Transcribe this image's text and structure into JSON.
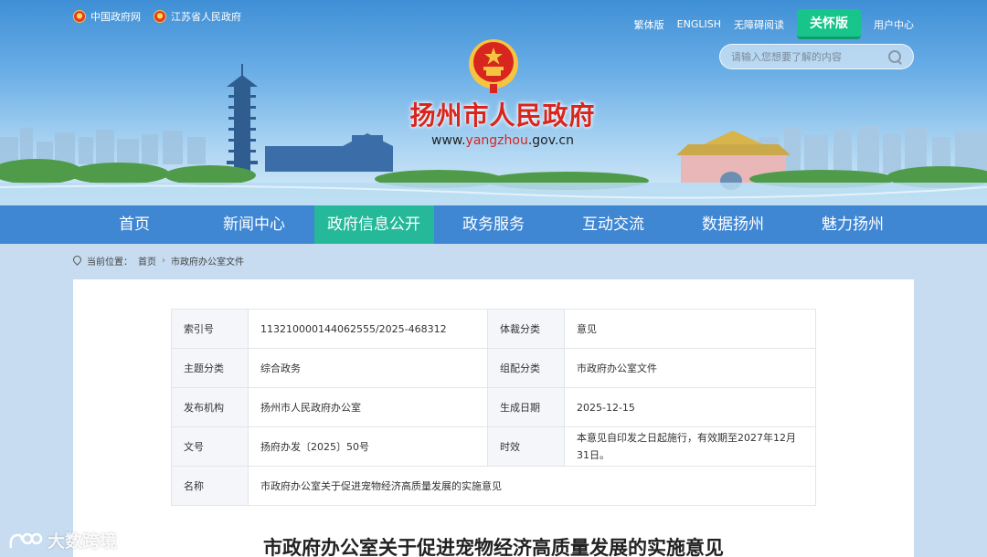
{
  "header": {
    "top_links": [
      "中国政府网",
      "江苏省人民政府"
    ],
    "right_links": [
      "繁体版",
      "ENGLISH",
      "无障碍阅读"
    ],
    "care_button": "关怀版",
    "user_center": "用户中心",
    "search_placeholder": "请输入您想要了解的内容",
    "site_title": "扬州市人民政府",
    "site_url_prefix": "www.",
    "site_url_highlight": "yangzhou",
    "site_url_suffix": ".gov.cn"
  },
  "nav": {
    "items": [
      "首页",
      "新闻中心",
      "政府信息公开",
      "政务服务",
      "互动交流",
      "数据扬州",
      "魅力扬州"
    ],
    "active_index": 2
  },
  "breadcrumb": {
    "label": "当前位置：",
    "items": [
      "首页",
      "市政府办公室文件"
    ]
  },
  "meta_table": {
    "rows": [
      {
        "k1": "索引号",
        "v1": "113210000144062555/2025-468312",
        "k2": "体裁分类",
        "v2": "意见"
      },
      {
        "k1": "主题分类",
        "v1": "综合政务",
        "k2": "组配分类",
        "v2": "市政府办公室文件"
      },
      {
        "k1": "发布机构",
        "v1": "扬州市人民政府办公室",
        "k2": "生成日期",
        "v2": "2025-12-15"
      },
      {
        "k1": "文号",
        "v1": "扬府办发〔2025〕50号",
        "k2": "时效",
        "v2": "本意见自印发之日起施行，有效期至2027年12月31日。"
      }
    ],
    "name_label": "名称",
    "name_value": "市政府办公室关于促进宠物经济高质量发展的实施意见"
  },
  "document": {
    "title": "市政府办公室关于促进宠物经济高质量发展的实施意见"
  },
  "watermark": {
    "text": "大数跨境"
  },
  "colors": {
    "nav_bg": "#3f86d3",
    "nav_active": "#25b99a",
    "title_red": "#d8261e",
    "care_green": "#17c58a"
  }
}
